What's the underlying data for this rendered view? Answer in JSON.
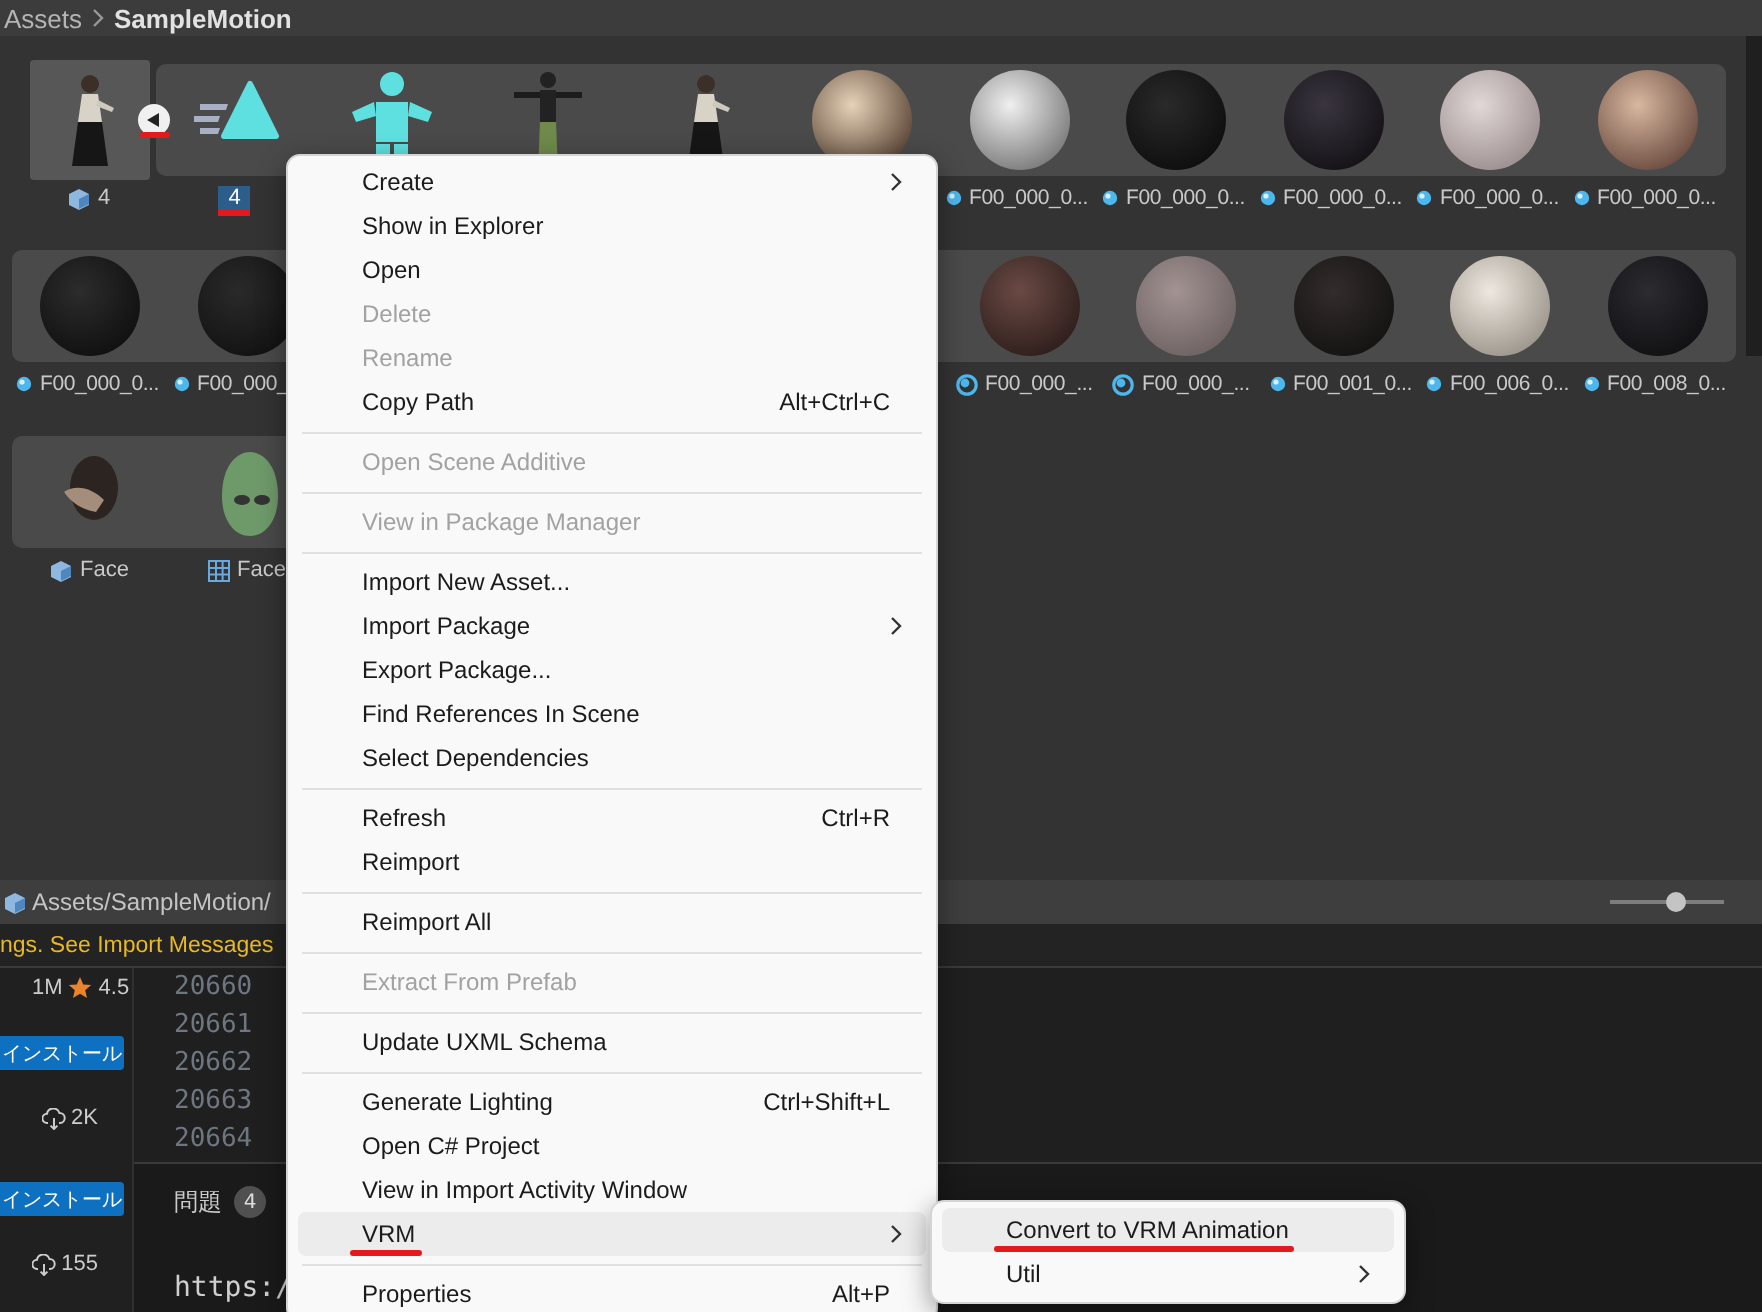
{
  "breadcrumb": [
    {
      "label": "Assets",
      "current": false
    },
    {
      "label": "SampleMotion",
      "current": true
    }
  ],
  "asset_rows": [
    {
      "lead_items": [
        {
          "kind": "figure",
          "label": {
            "text": "4",
            "kind": "prefab"
          },
          "selected": false,
          "annotated": false
        }
      ],
      "collapse_button": {
        "annotated": true
      },
      "group_items": [
        {
          "kind": "animation",
          "label": {
            "text": "4",
            "kind": "plain"
          },
          "selected": true,
          "annotated": true
        },
        {
          "kind": "avatar"
        },
        {
          "kind": "tpose"
        },
        {
          "kind": "figure"
        },
        {
          "kind": "material"
        },
        {
          "kind": "material",
          "label": {
            "text": "F00_000_0...",
            "kind": "material"
          },
          "selected": false,
          "annotated": false
        },
        {
          "kind": "material",
          "label": {
            "text": "F00_000_0...",
            "kind": "material"
          },
          "selected": false,
          "annotated": false
        },
        {
          "kind": "material",
          "label": {
            "text": "F00_000_0...",
            "kind": "material"
          },
          "selected": false,
          "annotated": false
        },
        {
          "kind": "material",
          "label": {
            "text": "F00_000_0...",
            "kind": "material"
          },
          "selected": false,
          "annotated": false
        },
        {
          "kind": "material",
          "label": {
            "text": "F00_000_0...",
            "kind": "material"
          },
          "selected": false,
          "annotated": false
        }
      ]
    },
    {
      "group_items": [
        {
          "kind": "material",
          "label": {
            "text": "F00_000_0...",
            "kind": "material"
          },
          "selected": false,
          "annotated": false
        },
        {
          "kind": "material",
          "label": {
            "text": "F00_000_",
            "kind": "material"
          },
          "selected": false,
          "annotated": false
        }
      ],
      "group_items_right": [
        {
          "kind": "material",
          "label": {
            "text": "F00_000_...",
            "kind": "material_ring"
          },
          "selected": false,
          "annotated": false
        },
        {
          "kind": "material",
          "label": {
            "text": "F00_000_...",
            "kind": "material_ring"
          },
          "selected": false,
          "annotated": false
        },
        {
          "kind": "material",
          "label": {
            "text": "F00_001_0...",
            "kind": "material"
          },
          "selected": false,
          "annotated": false
        },
        {
          "kind": "material",
          "label": {
            "text": "F00_006_0...",
            "kind": "material"
          },
          "selected": false,
          "annotated": false
        },
        {
          "kind": "material",
          "label": {
            "text": "F00_008_0...",
            "kind": "material"
          },
          "selected": false,
          "annotated": false
        }
      ]
    },
    {
      "group_items": [
        {
          "kind": "head",
          "label": {
            "text": "Face",
            "kind": "prefab"
          },
          "selected": false,
          "annotated": false
        },
        {
          "kind": "mask",
          "label": {
            "text": "Face",
            "kind": "mesh"
          },
          "selected": false,
          "annotated": false
        }
      ]
    }
  ],
  "status_bar": {
    "path": "Assets/SampleMotion/",
    "zoom_slider": {
      "level": 0.58
    }
  },
  "warning": "ngs. See Import Messages",
  "extensions_panel": {
    "downloads": "1M",
    "rating": "4.5",
    "entries": [
      {
        "button": "インストール",
        "count": "2K"
      },
      {
        "button": "インストール",
        "count": "155"
      }
    ]
  },
  "editor": {
    "line_numbers": [
      "20660",
      "20661",
      "20662",
      "20663",
      "20664"
    ],
    "problems_tab": {
      "label": "問題",
      "count": "4"
    },
    "text": "https:/"
  },
  "context_menu": {
    "items": [
      {
        "kind": "item",
        "label": "Create",
        "submenu": true,
        "disabled": false,
        "selected": false,
        "annotated": false
      },
      {
        "kind": "item",
        "label": "Show in Explorer",
        "submenu": false,
        "disabled": false,
        "selected": false,
        "annotated": false
      },
      {
        "kind": "item",
        "label": "Open",
        "submenu": false,
        "disabled": false,
        "selected": false,
        "annotated": false
      },
      {
        "kind": "item",
        "label": "Delete",
        "submenu": false,
        "disabled": true,
        "selected": false,
        "annotated": false
      },
      {
        "kind": "item",
        "label": "Rename",
        "submenu": false,
        "disabled": true,
        "selected": false,
        "annotated": false
      },
      {
        "kind": "item",
        "label": "Copy Path",
        "shortcut": "Alt+Ctrl+C",
        "submenu": false,
        "disabled": false,
        "selected": false,
        "annotated": false
      },
      {
        "kind": "separator"
      },
      {
        "kind": "item",
        "label": "Open Scene Additive",
        "submenu": false,
        "disabled": true,
        "selected": false,
        "annotated": false
      },
      {
        "kind": "separator"
      },
      {
        "kind": "item",
        "label": "View in Package Manager",
        "submenu": false,
        "disabled": true,
        "selected": false,
        "annotated": false
      },
      {
        "kind": "separator"
      },
      {
        "kind": "item",
        "label": "Import New Asset...",
        "submenu": false,
        "disabled": false,
        "selected": false,
        "annotated": false
      },
      {
        "kind": "item",
        "label": "Import Package",
        "submenu": true,
        "disabled": false,
        "selected": false,
        "annotated": false
      },
      {
        "kind": "item",
        "label": "Export Package...",
        "submenu": false,
        "disabled": false,
        "selected": false,
        "annotated": false
      },
      {
        "kind": "item",
        "label": "Find References In Scene",
        "submenu": false,
        "disabled": false,
        "selected": false,
        "annotated": false
      },
      {
        "kind": "item",
        "label": "Select Dependencies",
        "submenu": false,
        "disabled": false,
        "selected": false,
        "annotated": false
      },
      {
        "kind": "separator"
      },
      {
        "kind": "item",
        "label": "Refresh",
        "shortcut": "Ctrl+R",
        "submenu": false,
        "disabled": false,
        "selected": false,
        "annotated": false
      },
      {
        "kind": "item",
        "label": "Reimport",
        "submenu": false,
        "disabled": false,
        "selected": false,
        "annotated": false
      },
      {
        "kind": "separator"
      },
      {
        "kind": "item",
        "label": "Reimport All",
        "submenu": false,
        "disabled": false,
        "selected": false,
        "annotated": false
      },
      {
        "kind": "separator"
      },
      {
        "kind": "item",
        "label": "Extract From Prefab",
        "submenu": false,
        "disabled": true,
        "selected": false,
        "annotated": false
      },
      {
        "kind": "separator"
      },
      {
        "kind": "item",
        "label": "Update UXML Schema",
        "submenu": false,
        "disabled": false,
        "selected": false,
        "annotated": false
      },
      {
        "kind": "separator"
      },
      {
        "kind": "item",
        "label": "Generate Lighting",
        "shortcut": "Ctrl+Shift+L",
        "submenu": false,
        "disabled": false,
        "selected": false,
        "annotated": false
      },
      {
        "kind": "item",
        "label": "Open C# Project",
        "submenu": false,
        "disabled": false,
        "selected": false,
        "annotated": false
      },
      {
        "kind": "item",
        "label": "View in Import Activity Window",
        "submenu": false,
        "disabled": false,
        "selected": false,
        "annotated": false
      },
      {
        "kind": "item",
        "label": "VRM",
        "submenu": true,
        "disabled": false,
        "selected": true,
        "annotated": true
      },
      {
        "kind": "separator"
      },
      {
        "kind": "item",
        "label": "Properties",
        "shortcut": "Alt+P",
        "submenu": false,
        "disabled": false,
        "selected": false,
        "annotated": false
      }
    ]
  },
  "submenu": {
    "items": [
      {
        "kind": "item",
        "label": "Convert to VRM Animation",
        "submenu": false,
        "disabled": false,
        "selected": true,
        "annotated": true
      },
      {
        "kind": "item",
        "label": "Util",
        "submenu": true,
        "disabled": false,
        "selected": false,
        "annotated": false
      }
    ]
  }
}
